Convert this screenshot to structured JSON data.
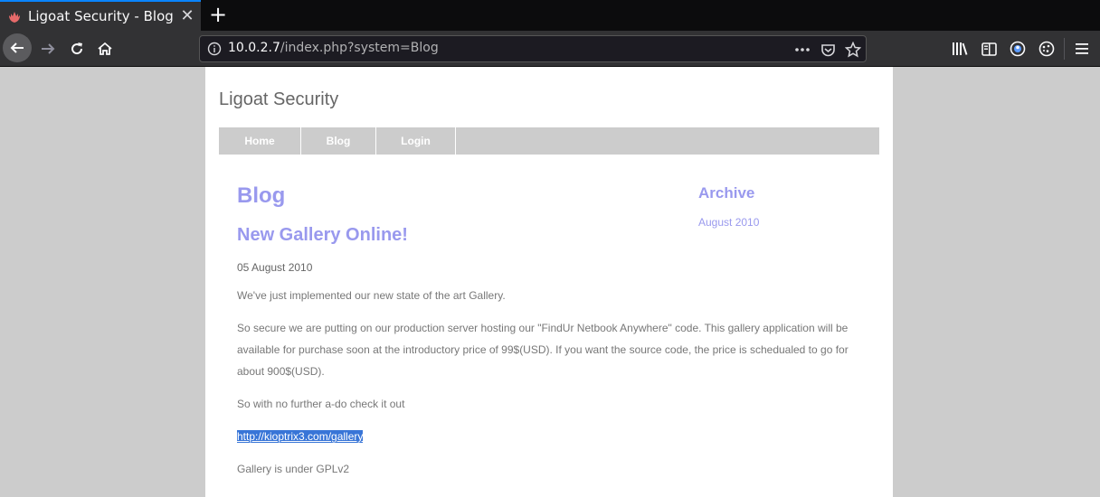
{
  "browser": {
    "tab_title": "Ligoat Security - Blog",
    "url_host": "10.0.2.7",
    "url_path": "/index.php?system=Blog",
    "icons": {
      "back": "back-arrow-icon",
      "forward": "forward-arrow-icon",
      "reload": "reload-icon",
      "home": "home-icon",
      "info": "info-icon",
      "more": "more-icon",
      "pocket": "pocket-icon",
      "bookmark": "star-icon",
      "library": "library-icon",
      "sidebar": "sidebar-icon",
      "account": "account-icon",
      "cookie": "cookie-icon",
      "menu": "hamburger-menu-icon"
    },
    "colors": {
      "tab_accent": "#0a84ff",
      "chrome": "#323234",
      "urlbar": "#1c1b22"
    }
  },
  "site": {
    "title": "Ligoat Security",
    "nav": [
      "Home",
      "Blog",
      "Login"
    ]
  },
  "main": {
    "heading": "Blog",
    "post": {
      "title": "New Gallery Online!",
      "date": "05 August 2010",
      "p1": "We've just implemented our new state of the art Gallery.",
      "p2": "So secure we are putting on our production server hosting our \"FindUr Netbook Anywhere\" code. This gallery application will be available for purchase soon at the introductory price of 99$(USD). If you want the source code, the price is schedualed to go for about 900$(USD).",
      "p3": "So with no further a-do check it out",
      "link": "http://kioptrix3.com/gallery",
      "p5": "Gallery is under GPLv2"
    }
  },
  "archive": {
    "heading": "Archive",
    "items": [
      "August 2010"
    ]
  },
  "colors": {
    "heading": "#9999ee",
    "nav_bg": "#cccccc",
    "selection": "#3875d7"
  }
}
